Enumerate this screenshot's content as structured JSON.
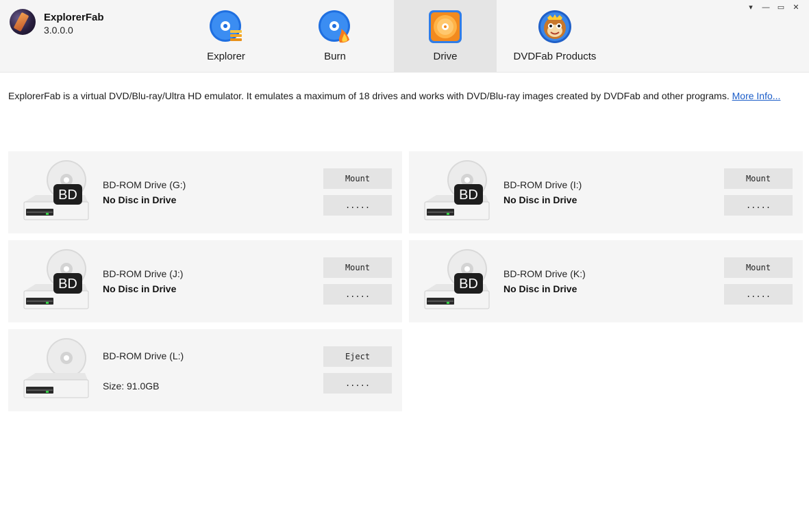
{
  "app": {
    "name": "ExplorerFab",
    "version": "3.0.0.0"
  },
  "window_controls": {
    "menu": "▾",
    "minimize": "—",
    "maximize": "▭",
    "close": "✕"
  },
  "nav": {
    "tabs": [
      {
        "label": "Explorer",
        "icon": "explorer-disc-icon",
        "active": false
      },
      {
        "label": "Burn",
        "icon": "burn-disc-icon",
        "active": false
      },
      {
        "label": "Drive",
        "icon": "drive-disc-icon",
        "active": true
      },
      {
        "label": "DVDFab Products",
        "icon": "dvdfab-monkey-icon",
        "active": false
      }
    ]
  },
  "description": {
    "text": "ExplorerFab is a virtual DVD/Blu-ray/Ultra HD emulator. It emulates a maximum of 18 drives and works with DVD/Blu-ray images created by DVDFab and other programs. ",
    "link": "More Info..."
  },
  "drives": [
    {
      "name": "BD-ROM Drive (G:)",
      "status": "No Disc in Drive",
      "badge": "BD",
      "primary_button": "Mount",
      "secondary_button": "....."
    },
    {
      "name": "BD-ROM Drive (I:)",
      "status": "No Disc in Drive",
      "badge": "BD",
      "primary_button": "Mount",
      "secondary_button": "....."
    },
    {
      "name": "BD-ROM Drive (J:)",
      "status": "No Disc in Drive",
      "badge": "BD",
      "primary_button": "Mount",
      "secondary_button": "....."
    },
    {
      "name": "BD-ROM Drive (K:)",
      "status": "No Disc in Drive",
      "badge": "BD",
      "primary_button": "Mount",
      "secondary_button": "....."
    },
    {
      "name": "BD-ROM Drive (L:)",
      "size": "Size: 91.0GB",
      "primary_button": "Eject",
      "secondary_button": "....."
    }
  ],
  "colors": {
    "link": "#1a5cc8",
    "card_bg": "#f5f5f5",
    "button_bg": "#e4e4e4",
    "active_tab": "#e5e5e5",
    "led": "#3ad34a"
  }
}
